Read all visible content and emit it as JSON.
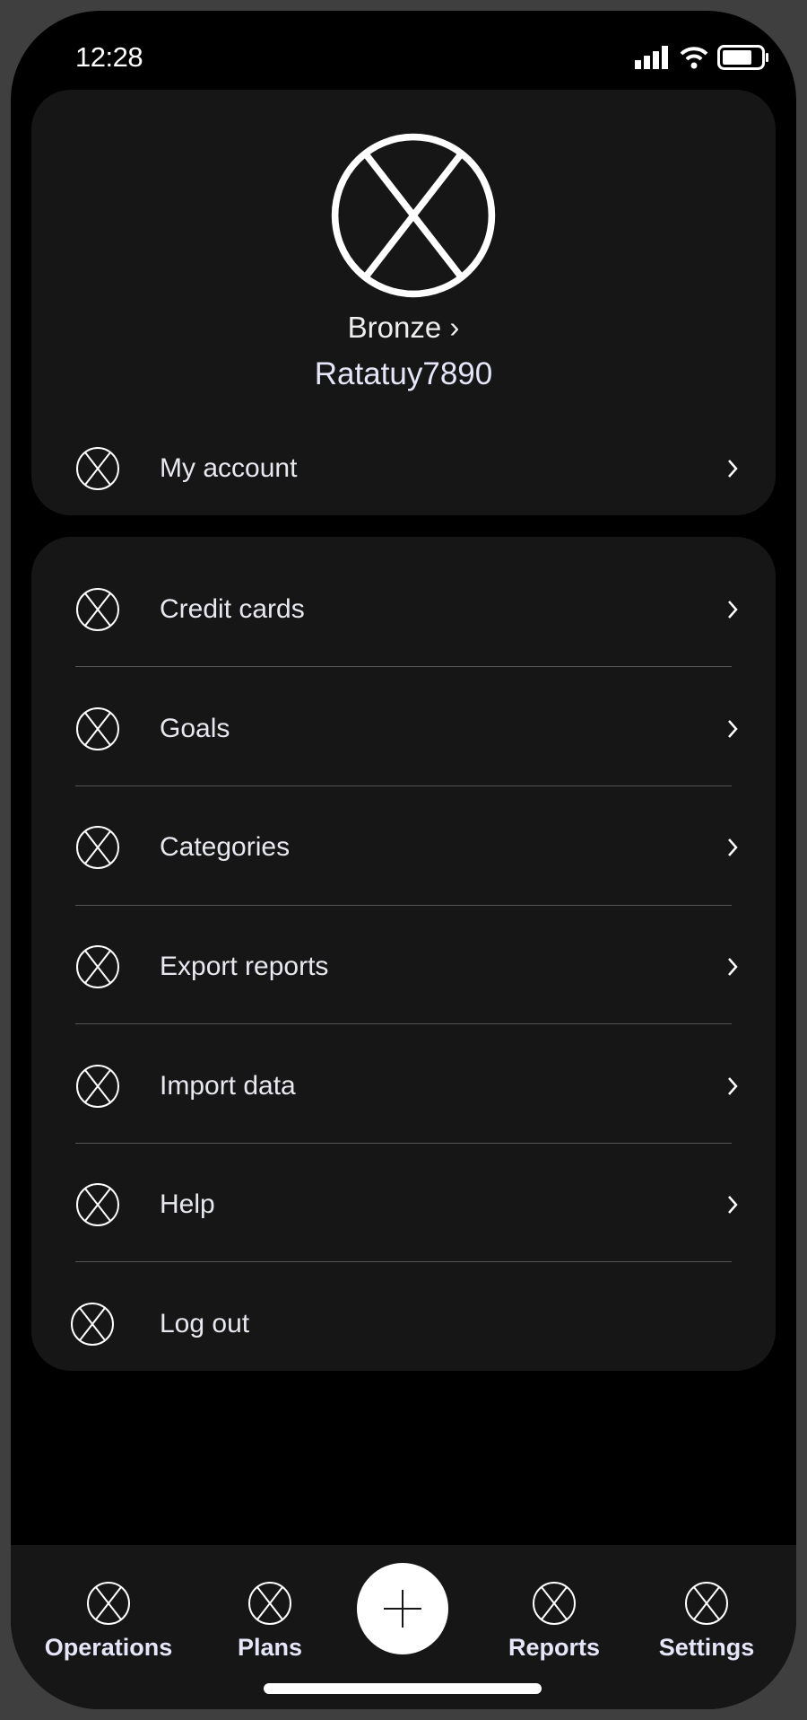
{
  "status_bar": {
    "time": "12:28",
    "icons": [
      "signal-icon",
      "wifi-icon",
      "battery-icon"
    ]
  },
  "profile": {
    "tier": "Bronze",
    "username": "Ratatuy7890",
    "account_label": "My account"
  },
  "menu": {
    "items": [
      {
        "label": "Credit cards",
        "chevron": true
      },
      {
        "label": "Goals",
        "chevron": true
      },
      {
        "label": "Categories",
        "chevron": true
      },
      {
        "label": "Export reports",
        "chevron": true
      },
      {
        "label": "Import data",
        "chevron": true
      },
      {
        "label": "Help",
        "chevron": true
      },
      {
        "label": "Log out",
        "chevron": false
      }
    ]
  },
  "nav": {
    "items": [
      {
        "label": "Operations"
      },
      {
        "label": "Plans"
      },
      {
        "label": "Reports"
      },
      {
        "label": "Settings"
      }
    ],
    "add_icon": "plus-icon"
  },
  "colors": {
    "background": "#000000",
    "card": "#161616",
    "text": "#e6e6fa"
  }
}
